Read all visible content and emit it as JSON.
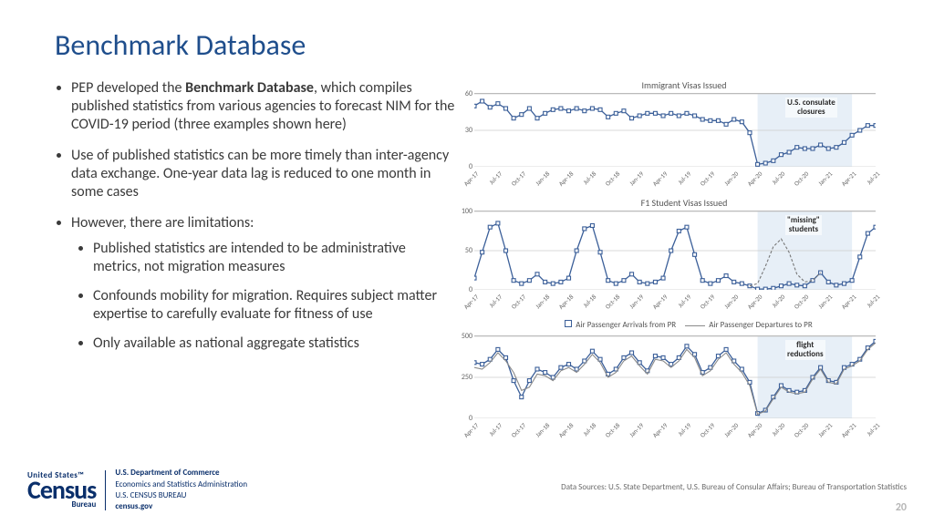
{
  "title": "Benchmark Database",
  "bullets": {
    "b1a": "PEP developed the ",
    "b1bold": "Benchmark Database",
    "b1b": ", which compiles published statistics from various agencies to forecast NIM for the COVID-19 period (three examples shown here)",
    "b2": "Use of published statistics can be more timely than inter-agency data exchange. One-year data lag is reduced to one month in some cases",
    "b3": "However, there are limitations:",
    "s1": "Published statistics are intended to be administrative metrics, not migration measures",
    "s2": "Confounds mobility for migration. Requires subject matter expertise to carefully evaluate for fitness of use",
    "s3": "Only available as national aggregate statistics"
  },
  "footer": {
    "us": "United States™",
    "census": "Census",
    "bureau": "Bureau",
    "d1": "U.S. Department of Commerce",
    "d2": "Economics and Statistics Administration",
    "d3": "U.S. CENSUS BUREAU",
    "d4": "census.gov"
  },
  "sources": "Data Sources: U.S. State Department, U.S. Bureau of Consular Affairs; Bureau of Transportation Statistics",
  "page": "20",
  "legend": {
    "s1": "Air Passenger Arrivals from PR",
    "s2": "Air Passenger Departures to PR"
  },
  "chart_data": [
    {
      "type": "line",
      "title": "Immigrant Visas Issued",
      "ylim": [
        0,
        60
      ],
      "yticks": [
        0,
        30,
        60
      ],
      "x": [
        "Apr-17",
        "May-17",
        "Jun-17",
        "Jul-17",
        "Aug-17",
        "Sep-17",
        "Oct-17",
        "Nov-17",
        "Dec-17",
        "Jan-18",
        "Feb-18",
        "Mar-18",
        "Apr-18",
        "May-18",
        "Jun-18",
        "Jul-18",
        "Aug-18",
        "Sep-18",
        "Oct-18",
        "Nov-18",
        "Dec-18",
        "Jan-19",
        "Feb-19",
        "Mar-19",
        "Apr-19",
        "May-19",
        "Jun-19",
        "Jul-19",
        "Aug-19",
        "Sep-19",
        "Oct-19",
        "Nov-19",
        "Dec-19",
        "Jan-20",
        "Feb-20",
        "Mar-20",
        "Apr-20",
        "May-20",
        "Jun-20",
        "Jul-20",
        "Aug-20",
        "Sep-20",
        "Oct-20",
        "Nov-20",
        "Dec-20",
        "Jan-21",
        "Feb-21",
        "Mar-21",
        "Apr-21",
        "May-21",
        "Jun-21",
        "Jul-21"
      ],
      "xticks": [
        "Apr-17",
        "Jul-17",
        "Oct-17",
        "Jan-18",
        "Apr-18",
        "Jul-18",
        "Oct-18",
        "Jan-19",
        "Apr-19",
        "Jul-19",
        "Oct-19",
        "Jan-20",
        "Apr-20",
        "Jul-20",
        "Oct-20",
        "Jan-21",
        "Apr-21",
        "Jul-21"
      ],
      "shade": [
        "Apr-20",
        "Apr-21"
      ],
      "callout": {
        "text": "U.S. consulate\nclosures",
        "at": "Nov-20"
      },
      "series": [
        {
          "name": "visas",
          "values": [
            50,
            54,
            49,
            52,
            48,
            40,
            43,
            48,
            40,
            44,
            47,
            48,
            46,
            48,
            46,
            48,
            47,
            41,
            44,
            46,
            40,
            42,
            44,
            44,
            42,
            44,
            42,
            44,
            42,
            39,
            38,
            38,
            35,
            39,
            37,
            28,
            2,
            3,
            5,
            10,
            12,
            16,
            15,
            15,
            18,
            15,
            16,
            20,
            26,
            30,
            34,
            34
          ]
        }
      ]
    },
    {
      "type": "line",
      "title": "F1 Student Visas Issued",
      "ylim": [
        0,
        100
      ],
      "yticks": [
        0,
        50,
        100
      ],
      "x": [
        "Apr-17",
        "May-17",
        "Jun-17",
        "Jul-17",
        "Aug-17",
        "Sep-17",
        "Oct-17",
        "Nov-17",
        "Dec-17",
        "Jan-18",
        "Feb-18",
        "Mar-18",
        "Apr-18",
        "May-18",
        "Jun-18",
        "Jul-18",
        "Aug-18",
        "Sep-18",
        "Oct-18",
        "Nov-18",
        "Dec-18",
        "Jan-19",
        "Feb-19",
        "Mar-19",
        "Apr-19",
        "May-19",
        "Jun-19",
        "Jul-19",
        "Aug-19",
        "Sep-19",
        "Oct-19",
        "Nov-19",
        "Dec-19",
        "Jan-20",
        "Feb-20",
        "Mar-20",
        "Apr-20",
        "May-20",
        "Jun-20",
        "Jul-20",
        "Aug-20",
        "Sep-20",
        "Oct-20",
        "Nov-20",
        "Dec-20",
        "Jan-21",
        "Feb-21",
        "Mar-21",
        "Apr-21",
        "May-21",
        "Jun-21",
        "Jul-21"
      ],
      "xticks": [
        "Apr-17",
        "Jul-17",
        "Oct-17",
        "Jan-18",
        "Apr-18",
        "Jul-18",
        "Oct-18",
        "Jan-19",
        "Apr-19",
        "Jul-19",
        "Oct-19",
        "Jan-20",
        "Apr-20",
        "Jul-20",
        "Oct-20",
        "Jan-21",
        "Apr-21",
        "Jul-21"
      ],
      "shade": [
        "Apr-20",
        "Apr-21"
      ],
      "callout": {
        "text": "\"missing\"\nstudents",
        "at": "Nov-20"
      },
      "series": [
        {
          "name": "f1",
          "values": [
            15,
            48,
            80,
            85,
            50,
            12,
            8,
            12,
            20,
            10,
            8,
            10,
            15,
            50,
            78,
            82,
            48,
            12,
            8,
            12,
            20,
            10,
            8,
            10,
            15,
            50,
            75,
            80,
            45,
            12,
            8,
            12,
            18,
            10,
            8,
            5,
            1,
            1,
            2,
            5,
            8,
            6,
            5,
            12,
            22,
            10,
            6,
            8,
            12,
            42,
            72,
            80
          ]
        },
        {
          "name": "missing_dash",
          "dashed": true,
          "values": [
            null,
            null,
            null,
            null,
            null,
            null,
            null,
            null,
            null,
            null,
            null,
            null,
            null,
            null,
            null,
            null,
            null,
            null,
            null,
            null,
            null,
            null,
            null,
            null,
            null,
            null,
            null,
            null,
            null,
            null,
            null,
            null,
            null,
            null,
            null,
            5,
            8,
            30,
            55,
            65,
            48,
            20,
            10,
            12,
            22,
            null,
            null,
            null,
            null,
            null,
            null,
            null
          ]
        }
      ]
    },
    {
      "type": "line",
      "title": "",
      "ylim": [
        0,
        500
      ],
      "yticks": [
        0,
        250,
        500
      ],
      "x": [
        "Apr-17",
        "May-17",
        "Jun-17",
        "Jul-17",
        "Aug-17",
        "Sep-17",
        "Oct-17",
        "Nov-17",
        "Dec-17",
        "Jan-18",
        "Feb-18",
        "Mar-18",
        "Apr-18",
        "May-18",
        "Jun-18",
        "Jul-18",
        "Aug-18",
        "Sep-18",
        "Oct-18",
        "Nov-18",
        "Dec-18",
        "Jan-19",
        "Feb-19",
        "Mar-19",
        "Apr-19",
        "May-19",
        "Jun-19",
        "Jul-19",
        "Aug-19",
        "Sep-19",
        "Oct-19",
        "Nov-19",
        "Dec-19",
        "Jan-20",
        "Feb-20",
        "Mar-20",
        "Apr-20",
        "May-20",
        "Jun-20",
        "Jul-20",
        "Aug-20",
        "Sep-20",
        "Oct-20",
        "Nov-20",
        "Dec-20",
        "Jan-21",
        "Feb-21",
        "Mar-21",
        "Apr-21",
        "May-21",
        "Jun-21",
        "Jul-21"
      ],
      "xticks": [
        "Apr-17",
        "Jul-17",
        "Oct-17",
        "Jan-18",
        "Apr-18",
        "Jul-18",
        "Oct-18",
        "Jan-19",
        "Apr-19",
        "Jul-19",
        "Oct-19",
        "Jan-20",
        "Apr-20",
        "Jul-20",
        "Oct-20",
        "Jan-21",
        "Apr-21",
        "Jul-21"
      ],
      "shade": [
        "Apr-20",
        "Apr-21"
      ],
      "callout": {
        "text": "flight\nreductions",
        "at": "Nov-20"
      },
      "series": [
        {
          "name": "Air Passenger Arrivals from PR",
          "values": [
            340,
            330,
            360,
            420,
            370,
            230,
            130,
            230,
            300,
            280,
            250,
            310,
            330,
            300,
            350,
            410,
            360,
            270,
            300,
            370,
            400,
            340,
            290,
            380,
            370,
            330,
            370,
            440,
            390,
            280,
            310,
            380,
            420,
            350,
            300,
            220,
            30,
            50,
            130,
            200,
            170,
            160,
            170,
            250,
            310,
            230,
            220,
            310,
            330,
            360,
            430,
            470
          ]
        },
        {
          "name": "Air Passenger Departures to PR",
          "plain": true,
          "values": [
            310,
            300,
            340,
            400,
            350,
            280,
            170,
            190,
            270,
            260,
            230,
            290,
            310,
            280,
            330,
            390,
            340,
            250,
            280,
            350,
            380,
            320,
            270,
            360,
            350,
            310,
            350,
            420,
            370,
            260,
            290,
            360,
            400,
            330,
            280,
            200,
            25,
            45,
            120,
            190,
            160,
            150,
            160,
            240,
            300,
            220,
            210,
            300,
            320,
            350,
            420,
            460
          ]
        }
      ]
    }
  ]
}
